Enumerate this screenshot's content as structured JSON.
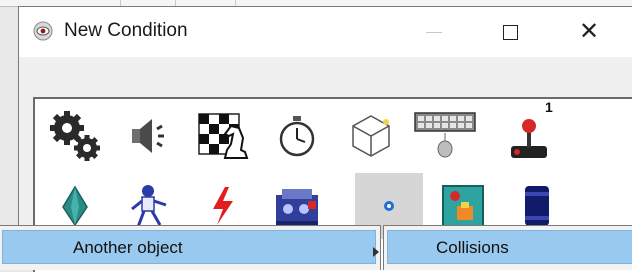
{
  "window": {
    "title": "New Condition",
    "icon": "eye-app-icon",
    "buttons": [
      "minimize",
      "maximize",
      "close"
    ],
    "close_glyph": "✕"
  },
  "condition_icons": {
    "row1": [
      {
        "name": "gears-icon",
        "label": ""
      },
      {
        "name": "speaker-icon",
        "label": ""
      },
      {
        "name": "chess-icon",
        "label": ""
      },
      {
        "name": "stopwatch-icon",
        "label": ""
      },
      {
        "name": "cube-icon",
        "label": ""
      },
      {
        "name": "keyboard-mouse-icon",
        "label": ""
      },
      {
        "name": "joystick-icon",
        "label": "1"
      }
    ],
    "row2": [
      {
        "name": "gem-icon"
      },
      {
        "name": "character-icon"
      },
      {
        "name": "lightning-icon"
      },
      {
        "name": "machine-icon"
      },
      {
        "name": "dot-object-icon",
        "selected": true
      },
      {
        "name": "painting-icon"
      },
      {
        "name": "barrel-icon"
      }
    ]
  },
  "context_menu": {
    "item": "Another object"
  },
  "submenu": {
    "item": "Collisions"
  },
  "colors": {
    "highlight": "#99c9ef",
    "window_bg": "#f0f0f0"
  }
}
